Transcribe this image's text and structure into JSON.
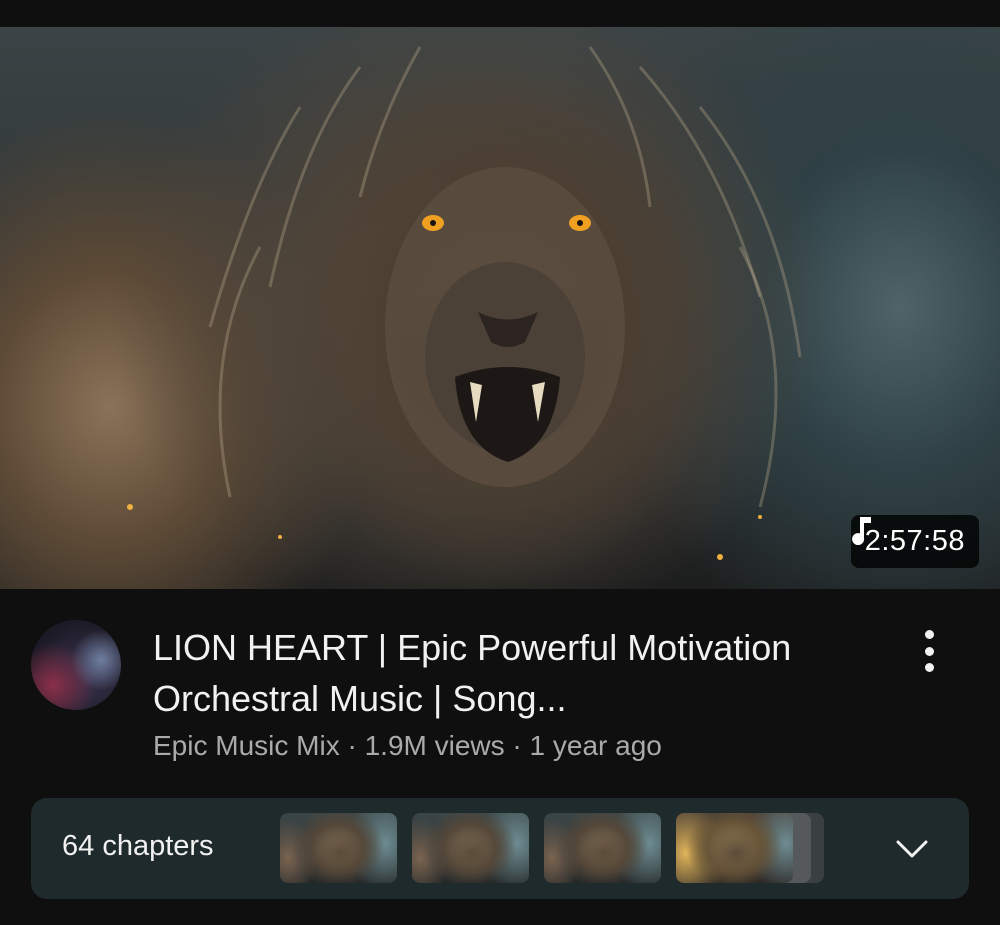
{
  "video": {
    "duration": "2:57:58",
    "title": "LION HEART | Epic Powerful Motivation Orchestral Music | Song...",
    "channel": "Epic Music Mix",
    "views": "1.9M views",
    "age": "1 year ago",
    "separator": " · "
  },
  "chapters": {
    "label": "64 chapters",
    "thumbnail_count": 4
  },
  "icons": {
    "duration": "music-note-icon",
    "menu": "vertical-ellipsis-icon",
    "expand": "chevron-down-icon"
  },
  "colors": {
    "background": "#0f0f0f",
    "chapters_bar": "#1f2a2d",
    "meta_text": "#aaaaaa",
    "primary_text": "#f1f1f1"
  }
}
